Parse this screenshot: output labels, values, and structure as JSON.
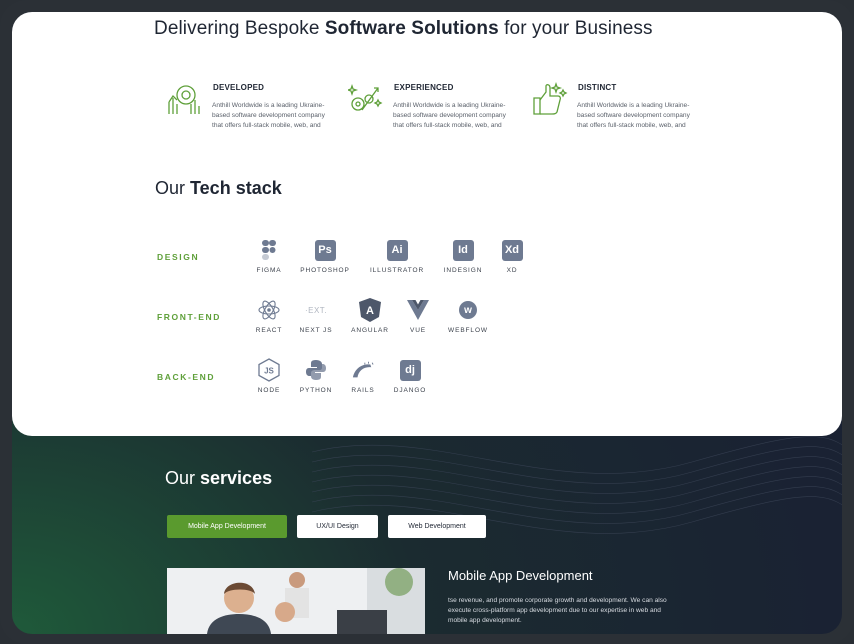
{
  "headline": {
    "pre": "Delivering Bespoke ",
    "bold": "Software Solutions",
    "post": " for your Business"
  },
  "features": [
    {
      "title": "DEVELOPED",
      "desc": "Anthill Worldwide is a leading Ukraine-based software development company that offers full-stack mobile, web, and",
      "icon": "development-icon"
    },
    {
      "title": "EXPERIENCED",
      "desc": "Anthill Worldwide is a leading Ukraine-based software development company that offers full-stack mobile, web, and",
      "icon": "experience-gears-icon"
    },
    {
      "title": "DISTINCT",
      "desc": "Anthill Worldwide is a leading Ukraine-based software development company that offers full-stack mobile, web, and",
      "icon": "thumbs-up-icon"
    }
  ],
  "tech": {
    "title_pre": "Our ",
    "title_bold": "Tech stack",
    "rows": [
      {
        "label": "DESIGN",
        "items": [
          "FIGMA",
          "PHOTOSHOP",
          "ILLUSTRATOR",
          "INDESIGN",
          "XD"
        ]
      },
      {
        "label": "FRONT-END",
        "items": [
          "REACT",
          "NEXT JS",
          "ANGULAR",
          "VUE",
          "WEBFLOW"
        ]
      },
      {
        "label": "BACK-END",
        "items": [
          "NODE",
          "PYTHON",
          "RAILS",
          "DJANGO"
        ]
      }
    ],
    "icon_text": {
      "ps": "Ps",
      "ai": "Ai",
      "id": "Id",
      "xd": "Xd",
      "next": "·EXT.",
      "dj": "dj",
      "webflow": "w",
      "angular": "A",
      "node": "JS"
    }
  },
  "services": {
    "title_pre": "Our ",
    "title_bold": "services",
    "tabs": [
      "Mobile App Development",
      "UX/UI Design",
      "Web Development"
    ],
    "active_tab": "Mobile App Development",
    "selected_title": "Mobile App Development",
    "selected_desc": "tse revenue, and promote corporate growth and development. We can also execute cross-platform app development due to our expertise in web and mobile app development."
  },
  "colors": {
    "accent": "#5a9a2e",
    "dark_bg": "#1a2233",
    "icon_box": "#6e7a91",
    "text": "#1f2633"
  }
}
